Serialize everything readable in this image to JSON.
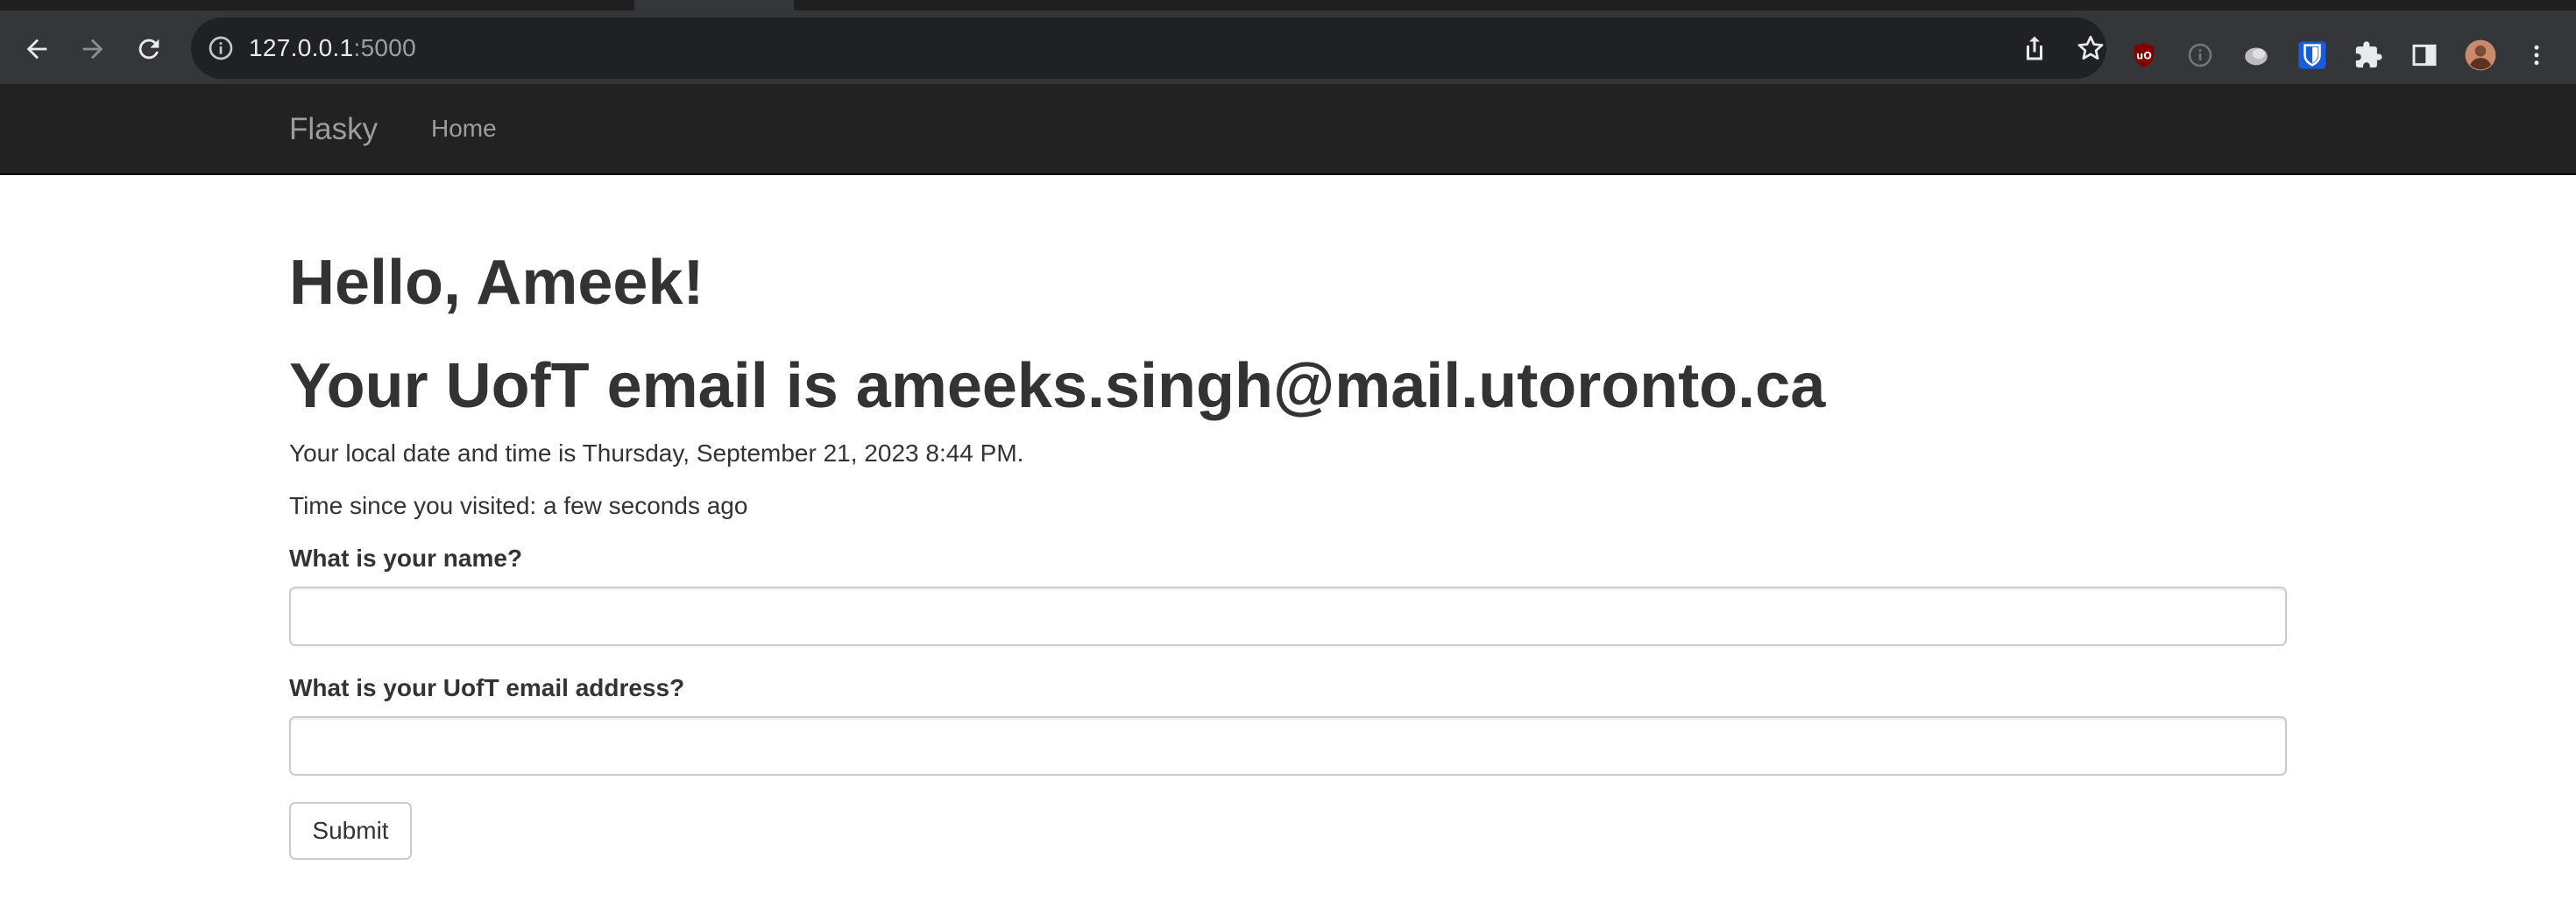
{
  "browser": {
    "url_host": "127.0.0.1",
    "url_port": ":5000",
    "icons": {
      "back": "back-arrow-icon",
      "forward": "forward-arrow-icon",
      "reload": "reload-icon",
      "info": "info-icon",
      "share": "share-icon",
      "bookmark": "star-icon",
      "ublock": "ublock-icon",
      "info_ext": "info-circle-icon",
      "ext_gray": "extension-gray-icon",
      "bitwarden": "bitwarden-icon",
      "extensions": "puzzle-icon",
      "side_panel": "side-panel-icon",
      "profile": "avatar",
      "menu": "kebab-menu-icon"
    }
  },
  "navbar": {
    "brand": "Flasky",
    "links": [
      {
        "label": "Home"
      }
    ]
  },
  "main": {
    "greeting": "Hello, Ameek!",
    "email_heading": "Your UofT email is ameeks.singh@mail.utoronto.ca",
    "local_time_text": "Your local date and time is Thursday, September 21, 2023 8:44 PM.",
    "visit_text": "Time since you visited: a few seconds ago"
  },
  "form": {
    "name_label": "What is your name?",
    "name_value": "",
    "email_label": "What is your UofT email address?",
    "email_value": "",
    "submit_label": "Submit"
  },
  "colors": {
    "navbar_bg": "#222222",
    "nav_text": "#9d9d9d",
    "text": "#333333",
    "input_border": "#cccccc"
  }
}
